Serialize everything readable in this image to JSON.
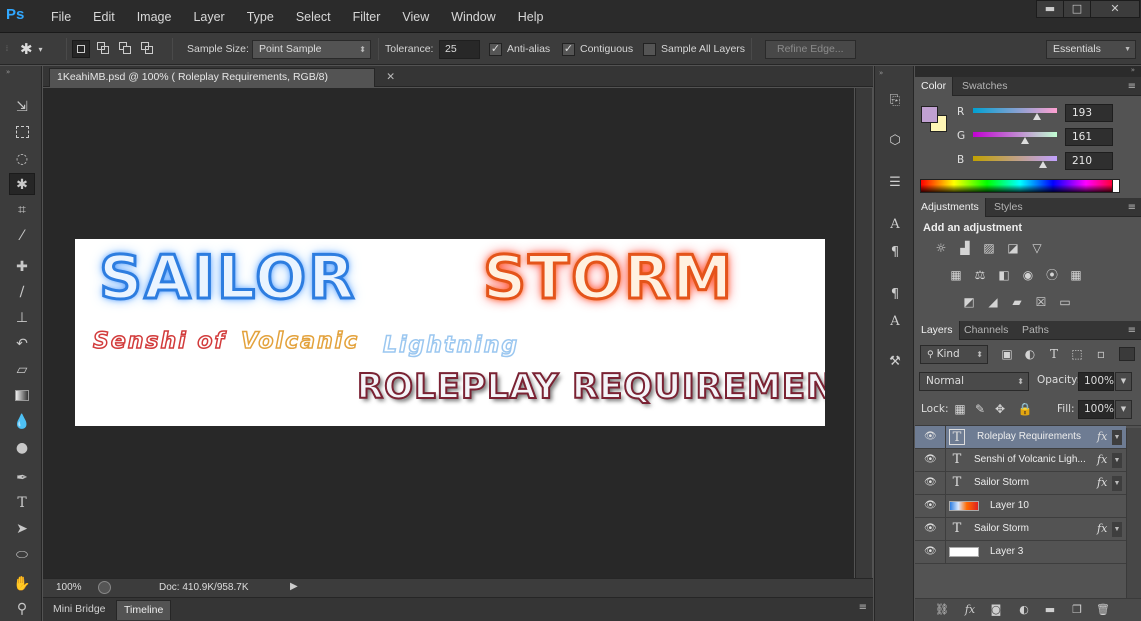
{
  "app": {
    "logo": "Ps"
  },
  "menu": [
    "File",
    "Edit",
    "Image",
    "Layer",
    "Type",
    "Select",
    "Filter",
    "View",
    "Window",
    "Help"
  ],
  "window_controls": {
    "minimize": "▬",
    "maximize": "□",
    "close": "✕"
  },
  "options": {
    "sample_size_label": "Sample Size:",
    "sample_size_value": "Point Sample",
    "tolerance_label": "Tolerance:",
    "tolerance_value": "25",
    "antialias_label": "Anti-alias",
    "antialias_checked": true,
    "contiguous_label": "Contiguous",
    "contiguous_checked": true,
    "sample_all_label": "Sample All Layers",
    "sample_all_checked": false,
    "refine_edge_label": "Refine Edge...",
    "workspace": "Essentials"
  },
  "document": {
    "tab_title": "1KeahiMB.psd @ 100% ( Roleplay Requirements, RGB/8)",
    "tab_close": "✕",
    "artwork": {
      "title_left": "SAILOR",
      "title_right": "STORM",
      "subtitle_1": "Senshi of",
      "subtitle_2": "Volcanic",
      "subtitle_3": "Lightning",
      "caption": "ROLEPLAY REQUIREMENTS"
    }
  },
  "status": {
    "zoom": "100%",
    "doc": "Doc: 410.9K/958.7K",
    "arrow": "▶"
  },
  "bottom_tabs": [
    "Mini Bridge",
    "Timeline"
  ],
  "color_panel": {
    "tabs": [
      "Color",
      "Swatches"
    ],
    "foreground": "#c1a1d2",
    "background": "#fff6b5",
    "channels": [
      {
        "label": "R",
        "value": "193"
      },
      {
        "label": "G",
        "value": "161"
      },
      {
        "label": "B",
        "value": "210"
      }
    ]
  },
  "adjustments_panel": {
    "tabs": [
      "Adjustments",
      "Styles"
    ],
    "title": "Add an adjustment"
  },
  "layers_panel": {
    "tabs": [
      "Layers",
      "Channels",
      "Paths"
    ],
    "filter_kind": "Kind",
    "blend_mode": "Normal",
    "opacity_label": "Opacity:",
    "opacity_value": "100%",
    "lock_label": "Lock:",
    "fill_label": "Fill:",
    "fill_value": "100%",
    "layers": [
      {
        "name": "Roleplay Requirements",
        "type": "text",
        "fx": true,
        "selected": true
      },
      {
        "name": "Senshi of  Volcanic Ligh...",
        "type": "text",
        "fx": true,
        "selected": false
      },
      {
        "name": "Sailor Storm",
        "type": "text",
        "fx": true,
        "selected": false
      },
      {
        "name": "Layer 10",
        "type": "image",
        "fx": false,
        "selected": false
      },
      {
        "name": "Sailor Storm",
        "type": "text",
        "fx": true,
        "selected": false
      },
      {
        "name": "Layer 3",
        "type": "image",
        "fx": false,
        "selected": false
      }
    ]
  }
}
